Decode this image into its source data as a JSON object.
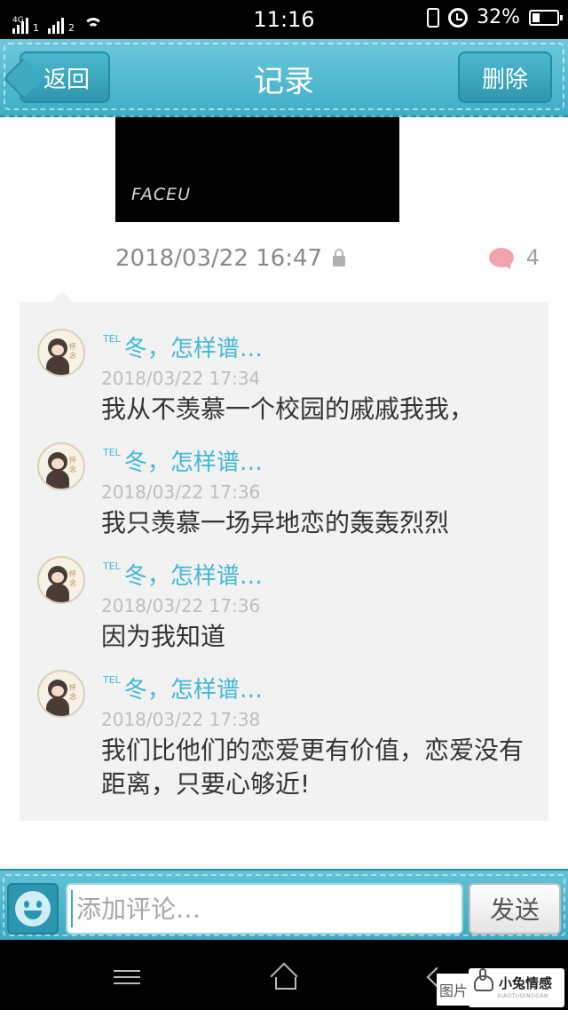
{
  "status_bar": {
    "network": "4G",
    "sim1": "1",
    "sim2": "2",
    "time": "11:16",
    "battery": "32%",
    "battery_fraction": 0.32
  },
  "header": {
    "back_label": "返回",
    "title": "记录",
    "delete_label": "删除"
  },
  "post": {
    "image_watermark": "FACEU",
    "timestamp": "2018/03/22 16:47",
    "comment_count": "4"
  },
  "comments": [
    {
      "name": "冬，怎样谱…",
      "name_prefix": "TEL",
      "avatar_text": "怀念",
      "time": "2018/03/22 17:34",
      "text": "我从不羡慕一个校园的戚戚我我，"
    },
    {
      "name": "冬，怎样谱…",
      "name_prefix": "TEL",
      "avatar_text": "怀念",
      "time": "2018/03/22 17:36",
      "text": "我只羡慕一场异地恋的轰轰烈烈"
    },
    {
      "name": "冬，怎样谱…",
      "name_prefix": "TEL",
      "avatar_text": "怀念",
      "time": "2018/03/22 17:36",
      "text": "因为我知道"
    },
    {
      "name": "冬，怎样谱…",
      "name_prefix": "TEL",
      "avatar_text": "怀念",
      "time": "2018/03/22 17:38",
      "text": "我们比他们的恋爱更有价值，恋爱没有距离，只要心够近!"
    }
  ],
  "input_bar": {
    "placeholder": "添加评论…",
    "send_label": "发送"
  },
  "watermark": {
    "left_text": "图片",
    "brand": "小兔情感",
    "sub": "XIAOTUQINGGAN"
  },
  "colors": {
    "accent": "#3eaec6",
    "name_color": "#43b8d6",
    "like_color": "#f2a4ae"
  }
}
